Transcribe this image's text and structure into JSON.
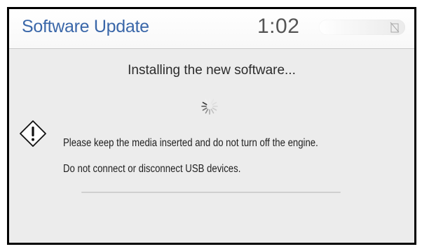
{
  "header": {
    "title": "Software Update",
    "clock": "1:02",
    "status_icon": "no-signal-icon"
  },
  "main": {
    "status_text": "Installing the new software...",
    "spinner_icon": "loading-spinner-icon",
    "warning_icon": "warning-diamond-icon",
    "notice_line_1": "Please keep the media inserted and do not turn off the engine.",
    "notice_line_2": "Do not connect or disconnect USB devices.",
    "progress_fraction": 0
  },
  "colors": {
    "title": "#3a67a9",
    "background": "#ececec",
    "header_background": "#ffffff",
    "text": "#1f1f1f"
  }
}
